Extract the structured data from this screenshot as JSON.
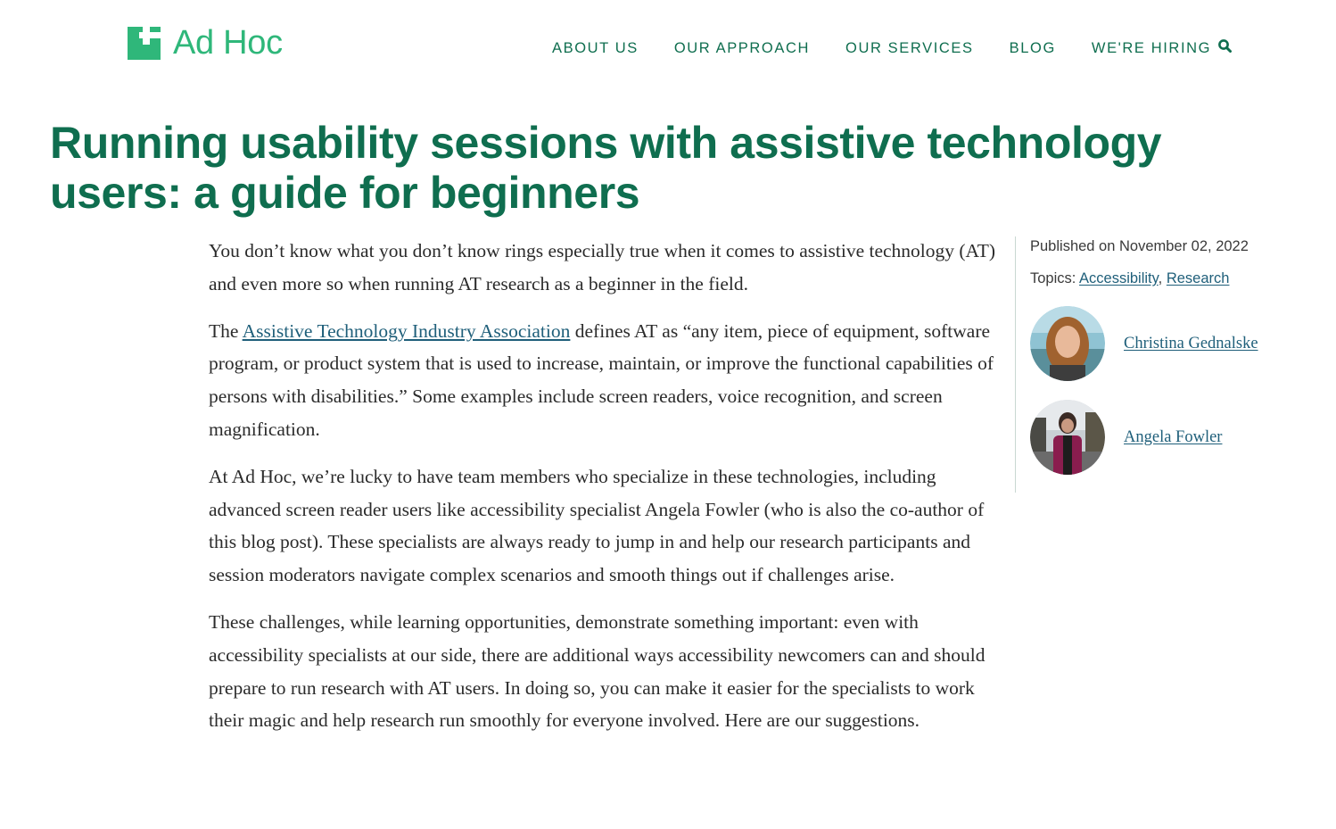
{
  "brand": {
    "name": "Ad Hoc",
    "color": "#2fb77a"
  },
  "nav": {
    "items": [
      {
        "label": "ABOUT US"
      },
      {
        "label": "OUR APPROACH"
      },
      {
        "label": "OUR SERVICES"
      },
      {
        "label": "BLOG"
      },
      {
        "label": "WE'RE HIRING"
      }
    ],
    "search_icon": "magnifier-icon"
  },
  "article": {
    "title": "Running usability sessions with assistive technology users: a guide for beginners",
    "p1": "You don’t know what you don’t know rings especially true when it comes to assistive technology (AT) and even more so when running AT research as a beginner in the field.",
    "p2_before": "The ",
    "p2_link": "Assistive Technology Industry Association",
    "p2_after": " defines AT as “any item, piece of equipment, software program, or product system that is used to increase, maintain, or improve the functional capabilities of persons with disabilities.” Some examples include screen readers, voice recognition, and screen magnification.",
    "p3": "At Ad Hoc, we’re lucky to have team members who specialize in these technologies, including advanced screen reader users like accessibility specialist Angela Fowler (who is also the co-author of this blog post). These specialists are always ready to jump in and help our research participants and session moderators navigate complex scenarios and smooth things out if challenges arise.",
    "p4": "These challenges, while learning opportunities, demonstrate something important: even with accessibility specialists at our side, there are additional ways accessibility newcomers can and should prepare to run research with AT users. In doing so, you can make it easier for the specialists to work their magic and help research run smoothly for everyone involved. Here are our suggestions."
  },
  "sidebar": {
    "published": "Published on November 02, 2022",
    "topics_label": "Topics: ",
    "topics": [
      {
        "label": "Accessibility"
      },
      {
        "label": "Research"
      }
    ],
    "topic_separator": ", ",
    "authors": [
      {
        "name": "Christina Gednalske"
      },
      {
        "name": "Angela Fowler"
      }
    ]
  },
  "colors": {
    "title": "#0f6e4f",
    "nav": "#0f6e4f",
    "link": "#1f5f7a",
    "body_text": "#2b2b2b",
    "divider": "#c9d7d2"
  }
}
